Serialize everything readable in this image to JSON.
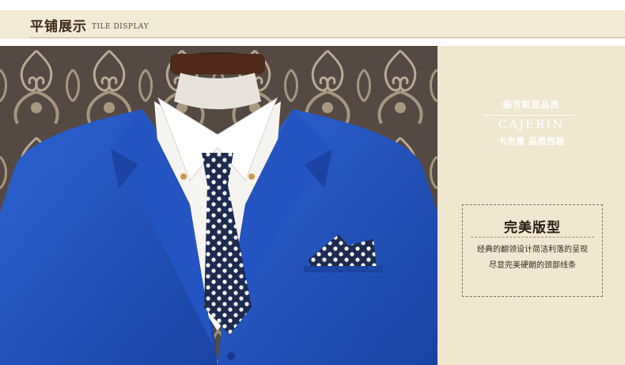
{
  "header": {
    "title": "平铺展示",
    "subtitle": "TILE DISPLAY"
  },
  "photo": {
    "subject": "blue-suit-on-mannequin-icon"
  },
  "panel": {
    "tagline": "细节彰显品质",
    "brand_en": "CAJERIN",
    "brand_cn": "卡杰雷  品质西装",
    "feature": {
      "title": "完美版型",
      "line1": "经典的翻领设计简洁利落的呈现",
      "line2": "尽显完美硬朗的颈部线条"
    }
  },
  "colors": {
    "header_bar": "#f1ead4",
    "suit_blue": "#1f4fb8",
    "panel_bg": "#efe7d0",
    "text_dark": "#2b1c12"
  }
}
